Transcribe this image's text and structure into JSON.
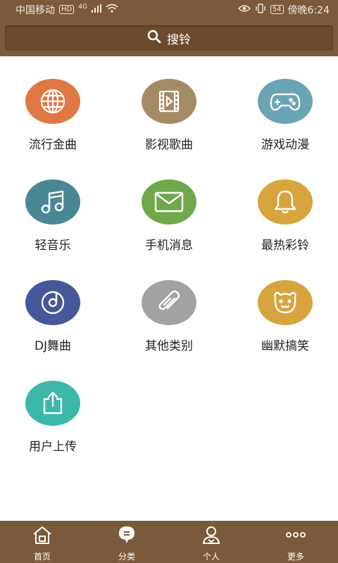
{
  "status_bar": {
    "carrier": "中国移动",
    "hd_badge": "HD",
    "network": "4G",
    "battery": "54",
    "time": "傍晚6:24"
  },
  "search": {
    "label": "搜铃"
  },
  "categories": [
    {
      "label": "流行金曲",
      "color": "#e07844",
      "icon": "globe-icon"
    },
    {
      "label": "影视歌曲",
      "color": "#a58a66",
      "icon": "video-icon"
    },
    {
      "label": "游戏动漫",
      "color": "#6ba5b5",
      "icon": "gamepad-icon"
    },
    {
      "label": "轻音乐",
      "color": "#4a8795",
      "icon": "music-note-icon"
    },
    {
      "label": "手机消息",
      "color": "#6fa84a",
      "icon": "envelope-icon"
    },
    {
      "label": "最热彩铃",
      "color": "#d8a43e",
      "icon": "bell-icon"
    },
    {
      "label": "DJ舞曲",
      "color": "#44589a",
      "icon": "disc-icon"
    },
    {
      "label": "其他类别",
      "color": "#a2a2a2",
      "icon": "paperclip-icon"
    },
    {
      "label": "幽默搞笑",
      "color": "#d8a43e",
      "icon": "smiley-icon"
    },
    {
      "label": "用户上传",
      "color": "#3cb8a8",
      "icon": "upload-icon"
    }
  ],
  "bottom_nav": [
    {
      "label": "首页",
      "icon": "home-icon"
    },
    {
      "label": "分类",
      "icon": "category-icon"
    },
    {
      "label": "个人",
      "icon": "person-icon"
    },
    {
      "label": "更多",
      "icon": "more-icon"
    }
  ]
}
